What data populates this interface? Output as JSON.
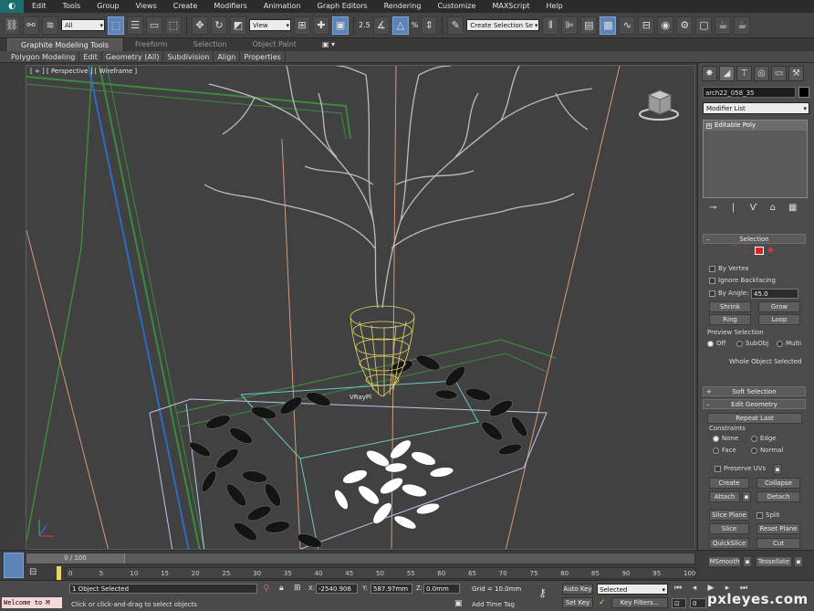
{
  "app": {
    "logo_glyph": "◐",
    "accent": "#5d84b8"
  },
  "menu": [
    "Edit",
    "Tools",
    "Group",
    "Views",
    "Create",
    "Modifiers",
    "Animation",
    "Graph Editors",
    "Rendering",
    "Customize",
    "MAXScript",
    "Help"
  ],
  "toolbar": {
    "filter_value": "All",
    "coord_value": "View",
    "snap_angle": "2.5",
    "percent": "%",
    "named_selection": "Create Selection Se"
  },
  "ribbon": {
    "tabs": [
      "Graphite Modeling Tools",
      "Freeform",
      "Selection",
      "Object Paint"
    ],
    "sub": [
      "Polygon Modeling",
      "Edit",
      "Geometry (All)",
      "Subdivision",
      "Align",
      "Properties"
    ]
  },
  "viewport": {
    "label": "[ + ] [ Perspective ] [ Wireframe ]",
    "object_label": "VRayPl"
  },
  "command_panel": {
    "object_name": "arch22_058_35",
    "modifier_list": "Modifier List",
    "stack_item": "Editable Poly",
    "selection": {
      "title": "Selection",
      "by_vertex": "By Vertex",
      "ignore_backfacing": "Ignore Backfacing",
      "by_angle": "By Angle:",
      "angle_value": "45.0",
      "shrink": "Shrink",
      "grow": "Grow",
      "ring": "Ring",
      "loop": "Loop",
      "preview_selection": "Preview Selection",
      "preview_options": [
        "Off",
        "SubObj",
        "Multi"
      ],
      "status": "Whole Object Selected"
    },
    "soft_selection": "Soft Selection",
    "edit_geometry": {
      "title": "Edit Geometry",
      "repeat_last": "Repeat Last",
      "constraints": "Constraints",
      "constraint_options": [
        "None",
        "Edge",
        "Face",
        "Normal"
      ],
      "preserve_uvs": "Preserve UVs",
      "create": "Create",
      "collapse": "Collapse",
      "attach": "Attach",
      "detach": "Detach",
      "slice_plane": "Slice Plane",
      "split": "Split",
      "slice": "Slice",
      "reset_plane": "Reset Plane",
      "quickslice": "QuickSlice",
      "cut": "Cut",
      "msmooth": "MSmooth",
      "tessellate": "Tessellate"
    }
  },
  "timeline": {
    "frame": "0 / 100",
    "ticks": [
      "0",
      "5",
      "10",
      "15",
      "20",
      "25",
      "30",
      "35",
      "40",
      "45",
      "50",
      "55",
      "60",
      "65",
      "70",
      "75",
      "80",
      "85",
      "90",
      "95",
      "100"
    ]
  },
  "status_bar": {
    "maxscript": "Welcome to M",
    "selected": "1 Object Selected",
    "prompt": "Click or click-and-drag to select objects",
    "x_label": "X:",
    "x_value": "-2540.906",
    "y_label": "Y:",
    "y_value": "587.97mm",
    "z_label": "Z:",
    "z_value": "0.0mm",
    "grid": "Grid = 10.0mm",
    "add_time_tag": "Add Time Tag",
    "auto_key": "Auto Key",
    "set_key": "Set Key",
    "key_mode": "Selected",
    "key_filters": "Key Filters...",
    "frame_field": "0"
  },
  "watermark": "pxleyes.com"
}
